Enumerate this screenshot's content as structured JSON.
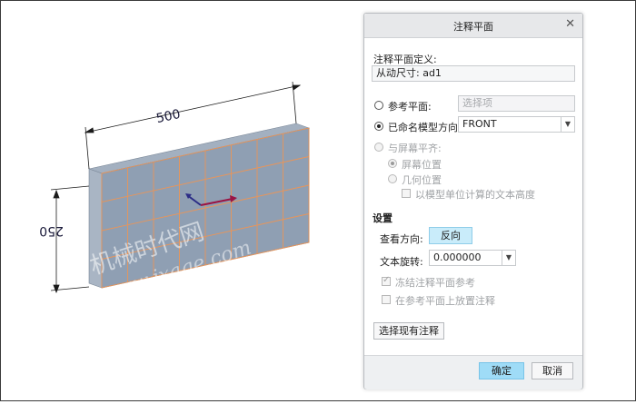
{
  "viewport": {
    "dimension_horizontal": "500",
    "dimension_vertical": "250",
    "watermark_line1": "机械时代网",
    "watermark_line2": "www.jxage.com"
  },
  "dialog": {
    "title": "注释平面",
    "close_icon": "close-icon",
    "definition": {
      "label": "注释平面定义:",
      "value": "从动尺寸: ad1"
    },
    "reference_plane": {
      "label": "参考平面:",
      "placeholder": "选择项",
      "selected": false
    },
    "named_direction": {
      "label": "已命名模型方向:",
      "value": "FRONT",
      "selected": true
    },
    "screen_align": {
      "label": "与屏幕平齐:",
      "enabled": false,
      "options": [
        {
          "label": "屏幕位置",
          "checked": true
        },
        {
          "label": "几何位置",
          "checked": false
        }
      ],
      "model_units_label": "以模型单位计算的文本高度"
    },
    "settings": {
      "header": "设置",
      "view_direction_label": "查看方向:",
      "flip_button": "反向",
      "text_rotation_label": "文本旋转:",
      "text_rotation_value": "0.000000",
      "freeze_label": "冻结注释平面参考",
      "place_on_plane_label": "在参考平面上放置注释"
    },
    "select_existing_button": "选择现有注释",
    "ok_button": "确定",
    "cancel_button": "取消"
  },
  "colors": {
    "plate_front": "#8f9fb3",
    "plate_grid": "#e8955a",
    "dimension_line": "#1a1a1a",
    "primary_button": "#9fdcf7"
  }
}
